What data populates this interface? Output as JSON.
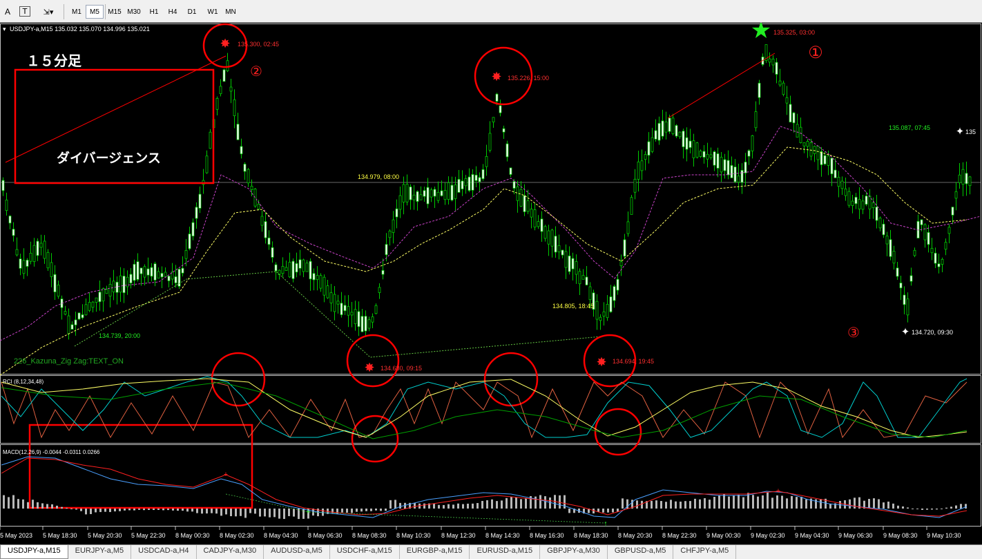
{
  "toolbar": {
    "text_tool": "A",
    "text_label_tool": "T",
    "timeframes": [
      "M1",
      "M5",
      "M15",
      "M30",
      "H1",
      "H4",
      "D1",
      "W1",
      "MN"
    ],
    "active_timeframe": "M5"
  },
  "chart": {
    "symbol_header": "USDJPY-a,M15  135.032 135.070 134.996 135.021",
    "indicator_name": "226_Kazuna_Zig Zag:TEXT_ON",
    "rci_header": "RCI (8,12,34,48)",
    "macd_header": "MACD(12,26,9) -0.0044 -0.0311 0.0266",
    "annotation_title": "１５分足",
    "annotation_divergence": "ダイバージェンス",
    "markers": [
      "①",
      "②",
      "③"
    ],
    "price_labels": [
      "135.300, 02:45",
      "135.226, 15:00",
      "135.325, 03:00",
      "135.087, 07:45",
      "135",
      "134.979, 08:00",
      "134.805, 18:45",
      "134.739, 20:00",
      "134.680, 09:15",
      "134.694, 19:45",
      "134.720, 09:30"
    ],
    "time_axis": [
      "5 May 2023",
      "5 May 18:30",
      "5 May 20:30",
      "5 May 22:30",
      "8 May 00:30",
      "8 May 02:30",
      "8 May 04:30",
      "8 May 06:30",
      "8 May 08:30",
      "8 May 10:30",
      "8 May 12:30",
      "8 May 14:30",
      "8 May 16:30",
      "8 May 18:30",
      "8 May 20:30",
      "8 May 22:30",
      "9 May 00:30",
      "9 May 02:30",
      "9 May 04:30",
      "9 May 06:30",
      "9 May 08:30",
      "9 May 10:30"
    ],
    "colors": {
      "bull": "#ffffff",
      "bear": "#00cc00",
      "annotation": "#ff0000",
      "rci_fast": "#e06040",
      "rci_mid": "#00d0d0",
      "rci_slow": "#ffff66",
      "rci_long": "#00a000",
      "macd_main": "#4aa0ff",
      "macd_signal": "#ff2020"
    }
  },
  "tabs": {
    "items": [
      "USDJPY-a,M15",
      "EURJPY-a,M5",
      "USDCAD-a,H4",
      "CADJPY-a,M30",
      "AUDUSD-a,M5",
      "USDCHF-a,M15",
      "EURGBP-a,M15",
      "EURUSD-a,M15",
      "GBPJPY-a,M30",
      "GBPUSD-a,M5",
      "CHFJPY-a,M5"
    ],
    "active": "USDJPY-a,M15"
  }
}
